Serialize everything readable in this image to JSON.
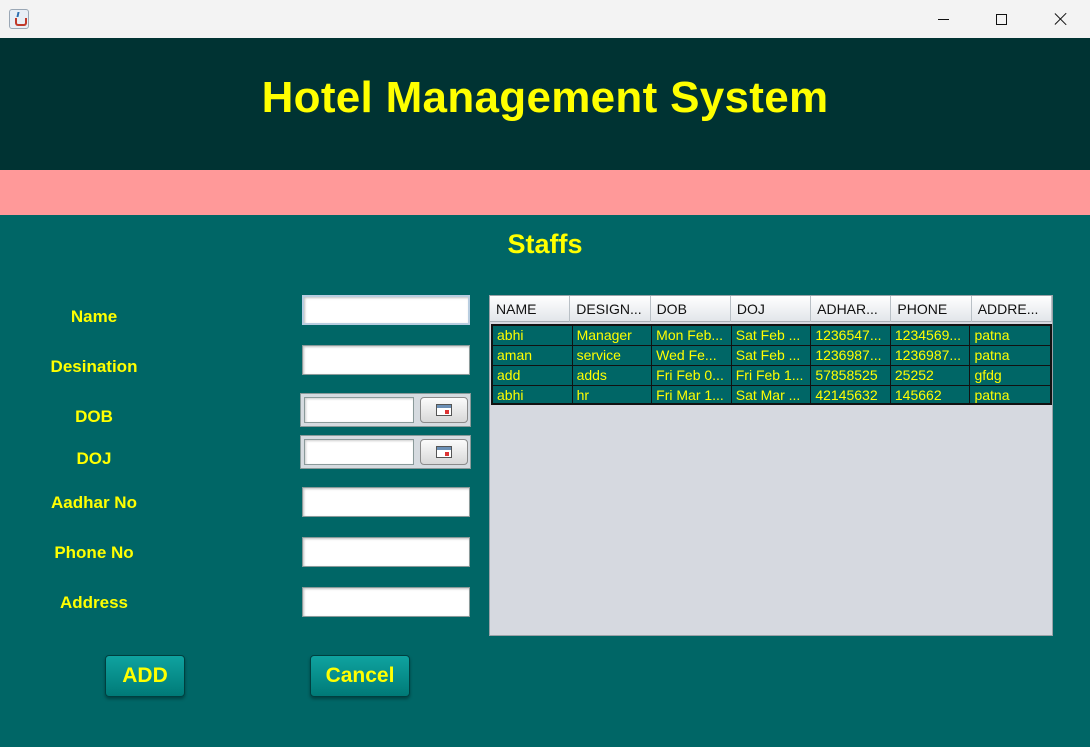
{
  "window": {
    "minimize_icon": "minimize-icon",
    "maximize_icon": "maximize-icon",
    "close_icon": "close-icon",
    "app_icon": "java-coffee-cup-icon"
  },
  "header": {
    "title": "Hotel Management System"
  },
  "colors": {
    "header_bg": "#003333",
    "band": "#ff9999",
    "panel_bg": "#006666",
    "accent_text": "#ffff00"
  },
  "section": {
    "title": "Staffs"
  },
  "form": {
    "name_label": "Name",
    "name_value": "",
    "designation_label": "Desination",
    "designation_value": "",
    "dob_label": "DOB",
    "dob_value": "",
    "doj_label": "DOJ",
    "doj_value": "",
    "aadhar_label": "Aadhar No",
    "aadhar_value": "",
    "phone_label": "Phone No",
    "phone_value": "",
    "address_label": "Address",
    "address_value": ""
  },
  "buttons": {
    "add": "ADD",
    "cancel": "Cancel"
  },
  "table": {
    "columns": [
      "NAME",
      "DESIGN...",
      "DOB",
      "DOJ",
      "ADHAR...",
      "PHONE",
      "ADDRE..."
    ],
    "rows": [
      [
        "abhi",
        "Manager",
        "Mon Feb...",
        "Sat Feb ...",
        "1236547...",
        "1234569...",
        "patna"
      ],
      [
        "aman",
        "service",
        "Wed Fe...",
        "Sat Feb ...",
        "1236987...",
        "1236987...",
        "patna"
      ],
      [
        "add",
        "adds",
        "Fri Feb 0...",
        "Fri Feb 1...",
        "57858525",
        "25252",
        "gfdg"
      ],
      [
        "abhi",
        "hr",
        "Fri Mar 1...",
        "Sat Mar ...",
        "42145632",
        "145662",
        "patna"
      ]
    ]
  }
}
